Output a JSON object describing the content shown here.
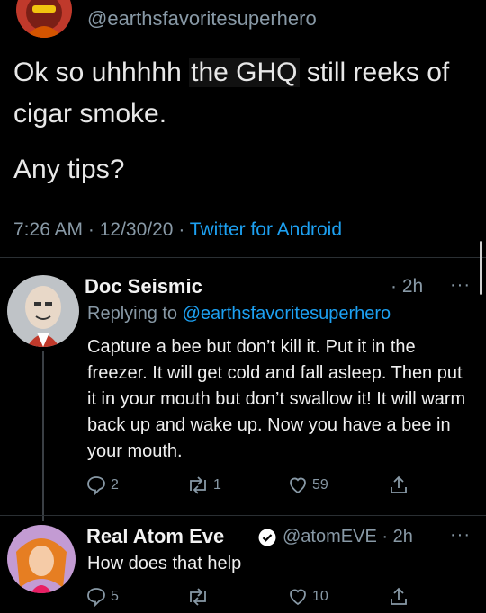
{
  "main_tweet": {
    "handle": "@earthsfavoritesuperhero",
    "text_before": "Ok so uhhhhh ",
    "text_highlight": "the GHQ",
    "text_after": " still reeks of cigar smoke.",
    "text_line2": "Any tips?",
    "time": "7:26 AM",
    "date": "12/30/20",
    "source": "Twitter for Android"
  },
  "reply1": {
    "name": "Doc Seismic",
    "time": "· 2h",
    "more": "···",
    "replying_label": "Replying to",
    "replying_handle": "@earthsfavoritesuperhero",
    "text": "Capture a bee but don’t kill it. Put it in the freezer. It will get cold and fall asleep. Then put it in your mouth but don’t swallow it! It will warm back up and wake up. Now you have a bee in your mouth.",
    "replies": "2",
    "retweets": "1",
    "likes": "59"
  },
  "reply2": {
    "name": "Real Atom Eve",
    "handle": "@atomEVE",
    "time": "· 2h",
    "more": "···",
    "text": "How does that help",
    "replies": "5",
    "retweets": "",
    "likes": "10"
  },
  "colors": {
    "background": "#000000",
    "muted": "#8899a6",
    "link": "#1da1f2"
  }
}
